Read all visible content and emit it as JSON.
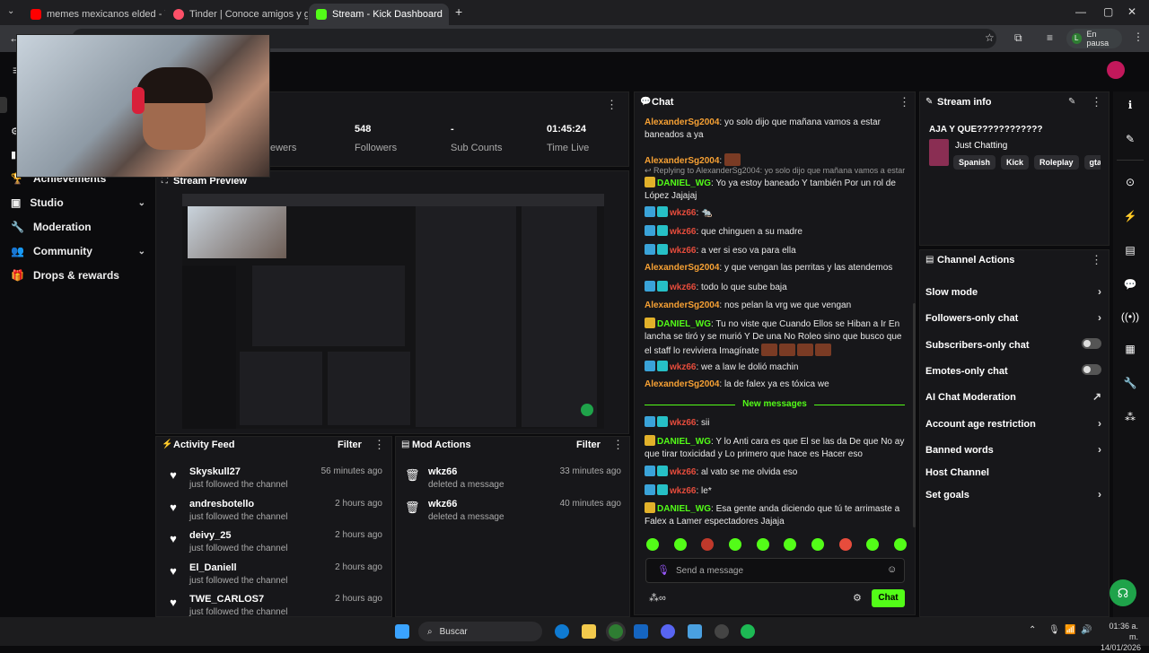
{
  "browser": {
    "tabs": [
      {
        "title": "memes mexicanos elded - YouT",
        "fav_color": "#ff0000"
      },
      {
        "title": "Tinder | Conoce amigos y gente",
        "fav_color": "#fd5068"
      },
      {
        "title": "Stream - Kick Dashboard",
        "fav_color": "#53fc18"
      }
    ],
    "new_tab": "+",
    "profile_label": "En pausa",
    "profile_initial": "L",
    "win_min": "—",
    "win_max": "▢",
    "win_close": "✕"
  },
  "sidebar": {
    "items": [
      {
        "label": "Achievements",
        "icon": "trophy-icon"
      },
      {
        "label": "Studio",
        "icon": "studio-icon",
        "chevron": "⌄"
      },
      {
        "label": "Moderation",
        "icon": "wrench-icon"
      },
      {
        "label": "Community",
        "icon": "people-icon",
        "chevron": "⌄"
      },
      {
        "label": "Drops & rewards",
        "icon": "gift-icon"
      }
    ]
  },
  "stats": {
    "viewers_label_partial": "ewers",
    "followers_value": "548",
    "followers_label": "Followers",
    "subs_value": "-",
    "subs_label": "Sub Counts",
    "time_value": "01:45:24",
    "time_label": "Time Live"
  },
  "stream_preview": {
    "title": "Stream Preview"
  },
  "activity_feed": {
    "title": "Activity Feed",
    "filter": "Filter",
    "items": [
      {
        "name": "Skyskull27",
        "sub": "just followed the channel",
        "time": "56 minutes ago"
      },
      {
        "name": "andresbotello",
        "sub": "just followed the channel",
        "time": "2 hours ago"
      },
      {
        "name": "deivy_25",
        "sub": "just followed the channel",
        "time": "2 hours ago"
      },
      {
        "name": "El_Daniell",
        "sub": "just followed the channel",
        "time": "2 hours ago"
      },
      {
        "name": "TWE_CARLOS7",
        "sub": "just followed the channel",
        "time": "2 hours ago"
      }
    ]
  },
  "mod_actions": {
    "title": "Mod Actions",
    "filter": "Filter",
    "items": [
      {
        "name": "wkz66",
        "sub": "deleted a message",
        "time": "33 minutes ago"
      },
      {
        "name": "wkz66",
        "sub": "deleted a message",
        "time": "40 minutes ago"
      }
    ]
  },
  "chat": {
    "title": "Chat",
    "messages": [
      {
        "user": "AlexanderSg2004",
        "color": "orange",
        "badges": [],
        "text": "yo solo dijo que mañana vamos a estar baneados a ya"
      },
      {
        "user": "AlexanderSg2004",
        "color": "orange",
        "badges": [],
        "text": "",
        "emotes": 1
      },
      {
        "reply": "Replying to AlexanderSg2004: yo solo dijo que mañana vamos a estar ..."
      },
      {
        "user": "DANIEL_WG",
        "color": "green",
        "badges": [
          "gold"
        ],
        "text": "Yo ya estoy baneado Y también Por un rol de López Jajajaj"
      },
      {
        "user": "wkz66",
        "color": "red",
        "badges": [
          "blue",
          "teal"
        ],
        "text": "🐀"
      },
      {
        "user": "wkz66",
        "color": "red",
        "badges": [
          "blue",
          "teal"
        ],
        "text": "que chinguen a su madre"
      },
      {
        "user": "wkz66",
        "color": "red",
        "badges": [
          "blue",
          "teal"
        ],
        "text": "a ver si eso va para ella"
      },
      {
        "user": "AlexanderSg2004",
        "color": "orange",
        "badges": [],
        "text": "y que vengan las perritas y las atendemos"
      },
      {
        "user": "wkz66",
        "color": "red",
        "badges": [
          "blue",
          "teal"
        ],
        "text": "todo lo que sube baja"
      },
      {
        "user": "AlexanderSg2004",
        "color": "orange",
        "badges": [],
        "text": "nos pelan la vrg we que vengan"
      },
      {
        "user": "DANIEL_WG",
        "color": "green",
        "badges": [
          "gold"
        ],
        "text": "Tu no viste que Cuando Ellos se Hiban a Ir En lancha se tiró y se murió Y De una No Roleo sino que busco que el staff lo reviviera Imagínate",
        "emotes": 4
      },
      {
        "user": "wkz66",
        "color": "red",
        "badges": [
          "blue",
          "teal"
        ],
        "text": "we a law le dolió machin"
      },
      {
        "user": "AlexanderSg2004",
        "color": "orange",
        "badges": [],
        "text": "la de falex ya es tóxica we"
      },
      {
        "divider": "New messages"
      },
      {
        "user": "wkz66",
        "color": "red",
        "badges": [
          "blue",
          "teal"
        ],
        "text": "sii"
      },
      {
        "user": "DANIEL_WG",
        "color": "green",
        "badges": [
          "gold"
        ],
        "text": "Y lo Anti cara es que El se las da De que No ay que tirar toxicidad y Lo primero que hace es Hacer eso"
      },
      {
        "user": "wkz66",
        "color": "red",
        "badges": [
          "blue",
          "teal"
        ],
        "text": "al vato se me olvida eso"
      },
      {
        "user": "wkz66",
        "color": "red",
        "badges": [
          "blue",
          "teal"
        ],
        "text": "le*"
      },
      {
        "user": "DANIEL_WG",
        "color": "green",
        "badges": [
          "gold"
        ],
        "text": "Esa gente anda diciendo que tú te arrimaste a Falex a Lamer espectadores Jajaja"
      }
    ],
    "input_placeholder": "Send a message",
    "send_label": "Chat"
  },
  "stream_info": {
    "title": "Stream info",
    "stream_title": "AJA Y QUE????????????",
    "category": "Just Chatting",
    "tags": [
      "Spanish",
      "Kick",
      "Roleplay",
      "gta"
    ]
  },
  "channel_actions": {
    "title": "Channel Actions",
    "items": [
      {
        "label": "Slow mode",
        "control": "chevron"
      },
      {
        "label": "Followers-only chat",
        "control": "chevron"
      },
      {
        "label": "Subscribers-only chat",
        "control": "toggle"
      },
      {
        "label": "Emotes-only chat",
        "control": "toggle"
      },
      {
        "label": "AI Chat Moderation",
        "control": "external"
      },
      {
        "label": "Account age restriction",
        "control": "chevron"
      },
      {
        "label": "Banned words",
        "control": "chevron"
      },
      {
        "label": "Host Channel",
        "control": "none"
      },
      {
        "label": "Set goals",
        "control": "chevron"
      }
    ]
  },
  "taskbar": {
    "search_label": "Buscar",
    "time": "01:36 a. m.",
    "date": "14/01/2026"
  },
  "colors": {
    "accent": "#53fc18",
    "bg": "#0b0b0d",
    "panel": "#17171a"
  }
}
